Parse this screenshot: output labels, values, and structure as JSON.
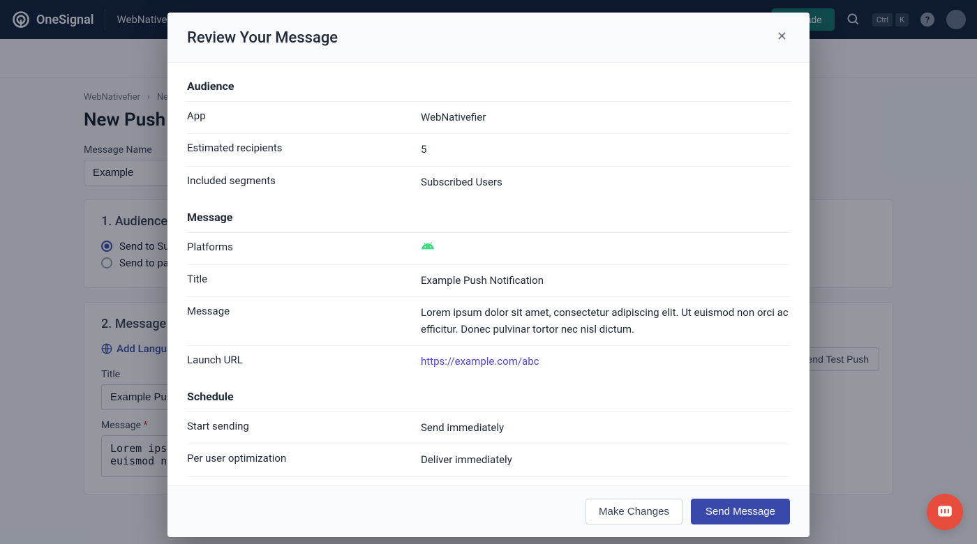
{
  "brand": "OneSignal",
  "header": {
    "app_name": "WebNativefier",
    "upgrade_label": "Upgrade",
    "kbd": [
      "Ctrl",
      "K"
    ]
  },
  "breadcrumb": {
    "item0": "WebNativefier",
    "item1": "New Push"
  },
  "page": {
    "title": "New Push Notification",
    "message_name_label": "Message Name",
    "message_name_value": "Example",
    "step1_title": "1. Audience",
    "radio1": "Send to Subscribed Users",
    "radio2": "Send to particular segment(s)",
    "step2_title": "2. Message",
    "add_languages": "Add Languages",
    "title_label": "Title",
    "title_value": "Example Push Notification",
    "message_label": "Message",
    "message_required": "*",
    "message_value": "Lorem ipsum dolor sit amet, consectetur adipiscing elit. Ut euismod non orci ac efficitur.",
    "send_test_label": "Send Test Push"
  },
  "dialog": {
    "title": "Review Your Message",
    "sections": {
      "audience": {
        "heading": "Audience",
        "rows": {
          "app": {
            "k": "App",
            "v": "WebNativefier"
          },
          "recipients": {
            "k": "Estimated recipients",
            "v": "5"
          },
          "segments": {
            "k": "Included segments",
            "v": "Subscribed Users"
          }
        }
      },
      "message": {
        "heading": "Message",
        "rows": {
          "platforms": {
            "k": "Platforms"
          },
          "title": {
            "k": "Title",
            "v": "Example Push Notification"
          },
          "body": {
            "k": "Message",
            "v": "Lorem ipsum dolor sit amet, consectetur adipiscing elit. Ut euismod non orci ac efficitur. Donec pulvinar tortor nec nisl dictum."
          },
          "url": {
            "k": "Launch URL",
            "v": "https://example.com/abc"
          }
        }
      },
      "schedule": {
        "heading": "Schedule",
        "rows": {
          "start": {
            "k": "Start sending",
            "v": "Send immediately"
          },
          "optimize": {
            "k": "Per user optimization",
            "v": "Deliver immediately"
          }
        }
      }
    },
    "footer": {
      "secondary": "Make Changes",
      "primary": "Send Message"
    }
  }
}
